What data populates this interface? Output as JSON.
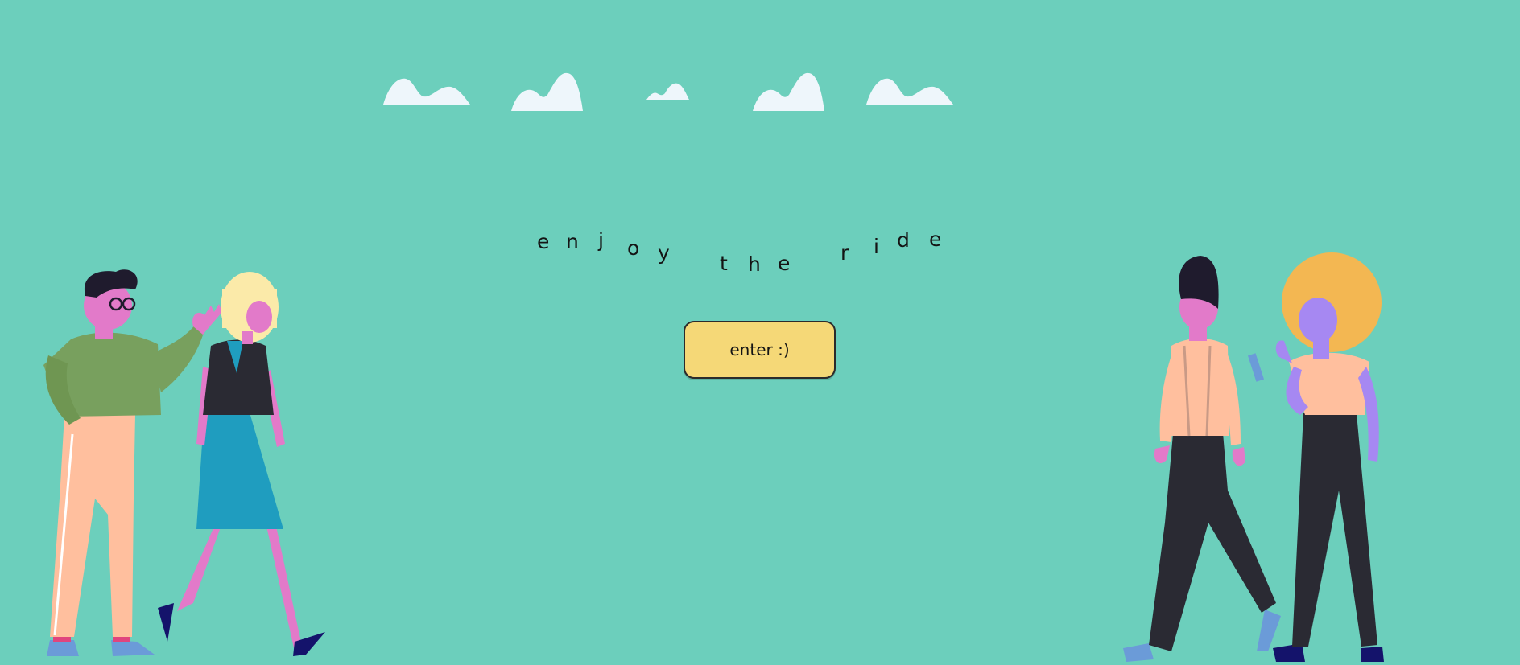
{
  "tagline": {
    "letters": [
      "e",
      "n",
      "j",
      "o",
      "y",
      "t",
      "h",
      "e",
      "r",
      "i",
      "d",
      "e"
    ]
  },
  "enter_button": {
    "label": "enter :)"
  },
  "colors": {
    "background": "#6ccfbc",
    "cloud": "#eef6fb",
    "button": "#f5d877",
    "text": "#141414"
  },
  "illustrations": {
    "left": "two-people-walking-talking",
    "right": "two-people-walking-phone"
  }
}
